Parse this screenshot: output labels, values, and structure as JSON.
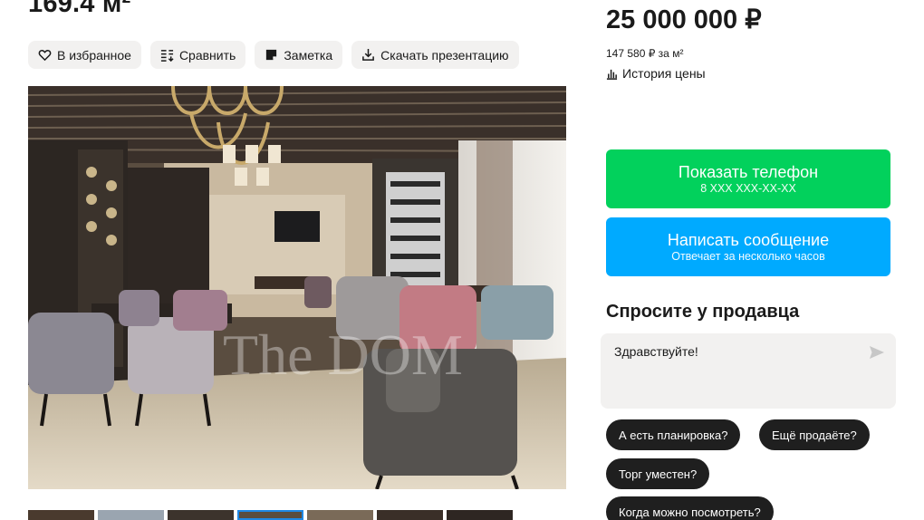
{
  "listing": {
    "title": "169.4 м²"
  },
  "actions": {
    "favorite": "В избранное",
    "compare": "Сравнить",
    "note": "Заметка",
    "download": "Скачать презентацию"
  },
  "gallery": {
    "watermark": "The DOM",
    "thumbnail_count": 7,
    "active_thumbnail": 4
  },
  "price": {
    "total": "25 000 000 ₽",
    "per_m2": "147 580 ₽ за м²",
    "history_label": "История цены"
  },
  "contact": {
    "phone_label": "Показать телефон",
    "phone_masked": "8 XXX XXX-XX-XX",
    "message_label": "Написать сообщение",
    "message_sub": "Отвечает за несколько часов"
  },
  "ask_seller": {
    "title": "Спросите у продавца",
    "input_value": "Здравствуйте!",
    "quick_questions": [
      "А есть планировка?",
      "Ещё продаёте?",
      "Торг уместен?",
      "Когда можно посмотреть?"
    ]
  },
  "colors": {
    "phone_button": "#02d15c",
    "message_button": "#00aaff",
    "chip": "#1f1f1f",
    "action_bg": "#f2f1f0"
  },
  "icons": [
    "heart-icon",
    "compare-icon",
    "note-icon",
    "download-icon",
    "chart-icon",
    "send-icon"
  ]
}
